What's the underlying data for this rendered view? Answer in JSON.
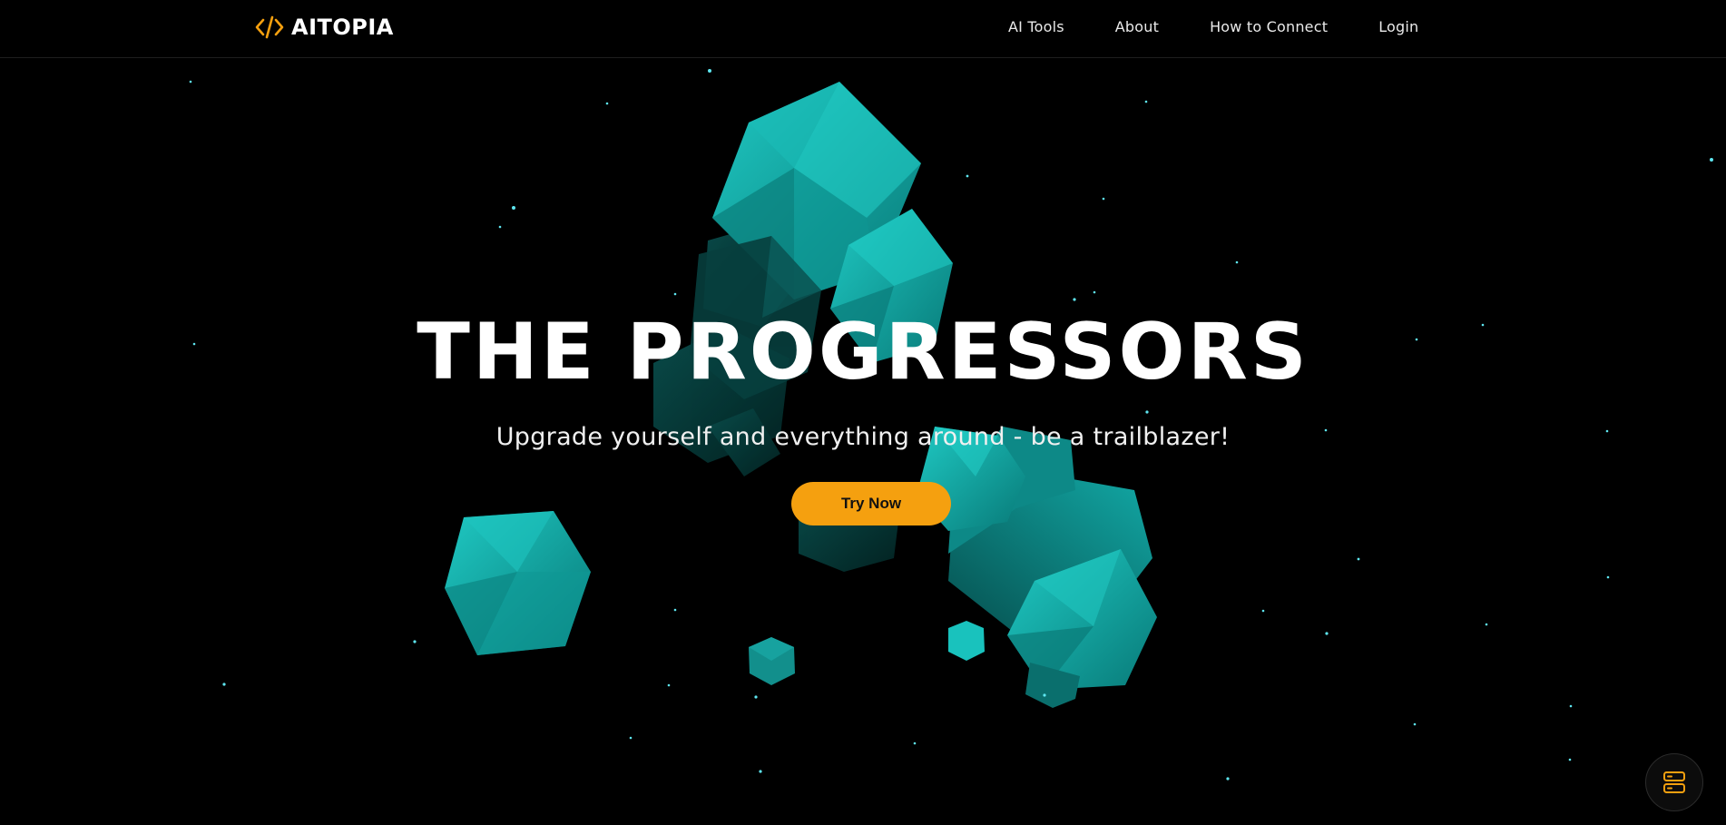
{
  "brand": {
    "name": "AITOPIA",
    "icon": "code-brackets-icon",
    "accent": "#f5a00f"
  },
  "nav": {
    "items": [
      {
        "label": "AI Tools"
      },
      {
        "label": "About"
      },
      {
        "label": "How to Connect"
      },
      {
        "label": "Login"
      }
    ]
  },
  "hero": {
    "title": "THE PROGRESSORS",
    "subtitle": "Upgrade yourself and everything around - be a trailblazer!",
    "cta_label": "Try Now"
  },
  "widget": {
    "icon": "server-stack-icon"
  },
  "colors": {
    "background": "#000000",
    "crystal": "#14b3b0",
    "crystal_dark": "#0a6f6e",
    "cta": "#f5a00f"
  }
}
